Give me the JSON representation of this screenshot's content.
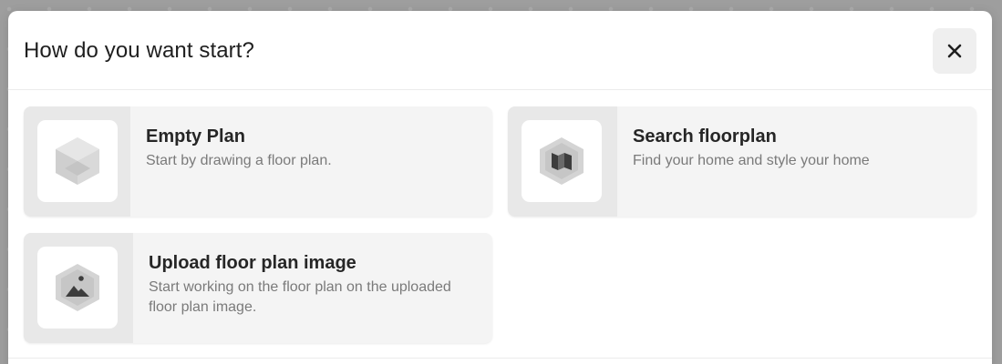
{
  "dialog": {
    "title": "How do you want start?",
    "close_label": "Close"
  },
  "options": [
    {
      "title": "Empty Plan",
      "description": "Start by drawing a floor plan.",
      "icon": "cube-icon"
    },
    {
      "title": "Search floorplan",
      "description": "Find your home and style your home",
      "icon": "map-icon"
    },
    {
      "title": "Upload floor plan image",
      "description": "Start working on the floor plan on the uploaded floor plan image.",
      "icon": "image-icon"
    }
  ],
  "colors": {
    "backdrop": "#9e9e9e",
    "card_background": "#f4f4f4",
    "icon_column": "#e8e8e8",
    "icon_gray": "#cfcfcf",
    "icon_dark": "#3d3d3d"
  }
}
